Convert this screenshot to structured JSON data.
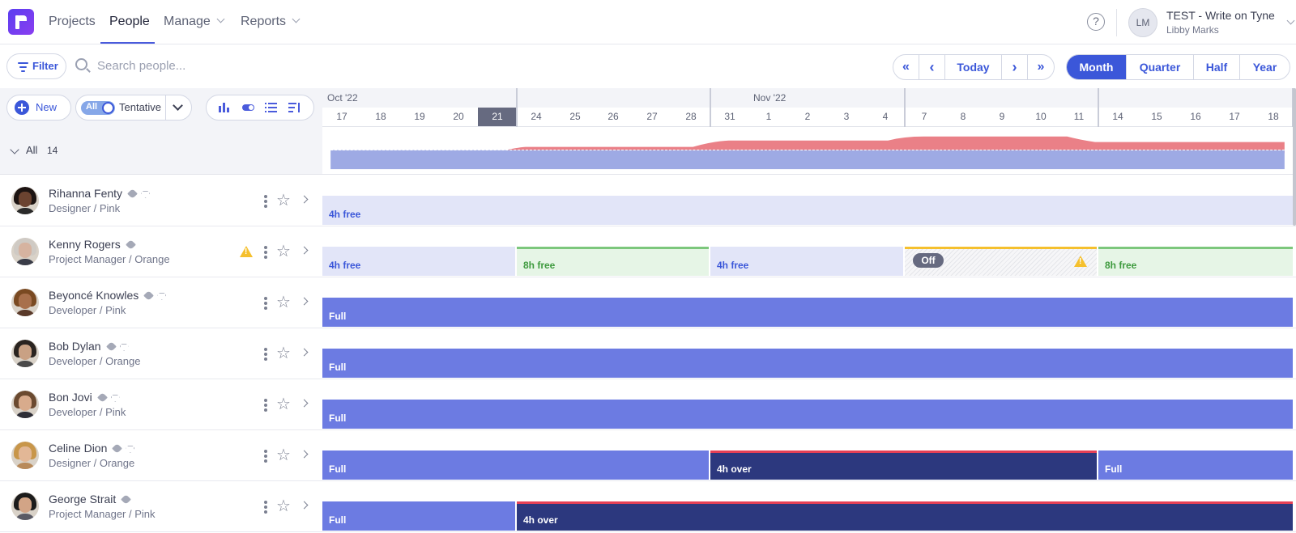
{
  "nav": {
    "items": [
      {
        "label": "Projects",
        "active": false,
        "dropdown": false
      },
      {
        "label": "People",
        "active": true,
        "dropdown": false
      },
      {
        "label": "Manage",
        "active": false,
        "dropdown": true
      },
      {
        "label": "Reports",
        "active": false,
        "dropdown": true
      }
    ],
    "help_icon": "?",
    "account": {
      "initials": "LM",
      "title": "TEST - Write on Tyne",
      "user": "Libby Marks"
    }
  },
  "toolbar": {
    "filter_label": "Filter",
    "search_placeholder": "Search people...",
    "pager": {
      "first_icon": "«",
      "prev_icon": "‹",
      "today": "Today",
      "next_icon": "›",
      "last_icon": "»"
    },
    "views": [
      {
        "label": "Month",
        "active": true
      },
      {
        "label": "Quarter",
        "active": false
      },
      {
        "label": "Half",
        "active": false
      },
      {
        "label": "Year",
        "active": false
      }
    ]
  },
  "controls": {
    "new_label": "New",
    "toggle_label": "All",
    "tentative_label": "Tentative"
  },
  "timeline": {
    "months": [
      "Oct '22",
      "Nov '22"
    ],
    "days": [
      "17",
      "18",
      "19",
      "20",
      "21",
      "24",
      "25",
      "26",
      "27",
      "28",
      "31",
      "1",
      "2",
      "3",
      "4",
      "7",
      "8",
      "9",
      "10",
      "11",
      "14",
      "15",
      "16",
      "17",
      "18"
    ],
    "today_label": "21"
  },
  "summary": {
    "label": "All",
    "count": "14"
  },
  "people": [
    {
      "name": "Rihanna Fenty",
      "role": "Designer / Pink",
      "diamond": true,
      "warning": false,
      "skin": "#6b4330",
      "hair": "#1d1412",
      "shirt": "#2a2a2a",
      "segments": [
        {
          "kind": "free",
          "label": "4h free",
          "start": 0,
          "days": 25
        }
      ]
    },
    {
      "name": "Kenny Rogers",
      "role": "Project Manager / Orange",
      "diamond": false,
      "warning": true,
      "skin": "#d6b3a0",
      "hair": "#cfcac4",
      "shirt": "#3a3c48",
      "segments": [
        {
          "kind": "free",
          "label": "4h free",
          "start": 0,
          "days": 5
        },
        {
          "kind": "freeg",
          "label": "8h free",
          "start": 5,
          "days": 5
        },
        {
          "kind": "free",
          "label": "4h free",
          "start": 10,
          "days": 5
        },
        {
          "kind": "off",
          "label": "Off",
          "start": 15,
          "days": 5
        },
        {
          "kind": "freeg",
          "label": "8h free",
          "start": 20,
          "days": 5
        }
      ]
    },
    {
      "name": "Beyoncé Knowles",
      "role": "Developer / Pink",
      "diamond": true,
      "warning": false,
      "skin": "#a8704c",
      "hair": "#7a4a22",
      "shirt": "#5a3a2a",
      "segments": [
        {
          "kind": "full",
          "label": "Full",
          "start": 0,
          "days": 25
        }
      ]
    },
    {
      "name": "Bob Dylan",
      "role": "Developer / Orange",
      "diamond": true,
      "warning": false,
      "skin": "#c9a184",
      "hair": "#2a2420",
      "shirt": "#4a4a4a",
      "segments": [
        {
          "kind": "full",
          "label": "Full",
          "start": 0,
          "days": 25
        }
      ]
    },
    {
      "name": "Bon Jovi",
      "role": "Developer / Pink",
      "diamond": true,
      "warning": false,
      "skin": "#d8ab8c",
      "hair": "#6b4a30",
      "shirt": "#2e2e36",
      "segments": [
        {
          "kind": "full",
          "label": "Full",
          "start": 0,
          "days": 25
        }
      ]
    },
    {
      "name": "Celine Dion",
      "role": "Designer / Orange",
      "diamond": true,
      "warning": false,
      "skin": "#e2b796",
      "hair": "#c8964a",
      "shirt": "#b88a5a",
      "segments": [
        {
          "kind": "full",
          "label": "Full",
          "start": 0,
          "days": 10
        },
        {
          "kind": "over",
          "label": "4h over",
          "start": 10,
          "days": 10
        },
        {
          "kind": "full",
          "label": "Full",
          "start": 20,
          "days": 5
        }
      ]
    },
    {
      "name": "George Strait",
      "role": "Project Manager / Pink",
      "diamond": false,
      "warning": false,
      "skin": "#d2a486",
      "hair": "#1c1c1c",
      "shirt": "#5a5a64",
      "segments": [
        {
          "kind": "full",
          "label": "Full",
          "start": 0,
          "days": 5
        },
        {
          "kind": "over",
          "label": "4h over",
          "start": 5,
          "days": 20
        }
      ]
    }
  ],
  "colors": {
    "accent": "#3b57d9",
    "free": "#e2e5f8",
    "full": "#6c7be2",
    "over": "#2c387e",
    "over_line": "#e64056",
    "free_green": "#e6f5e6",
    "warning": "#f5c02e",
    "capacity_area": "#9eaae4",
    "overbooked_area": "#ea8087"
  }
}
